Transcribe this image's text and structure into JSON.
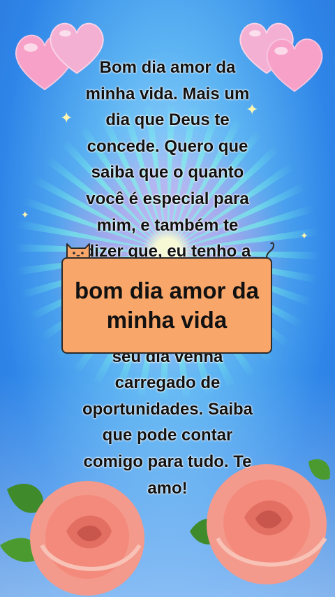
{
  "message": {
    "text": "Bom dia amor da\nminha vida. Mais um\ndia que Deus te\nconcede. Quero que\nsaiba que o quanto\nvocê é especial para\nmim, e também te\ndizer que, eu tenho a\n\n\namor e alegria. Que o\nseu dia venha\ncarregado de\noportunidades. Saiba\nque pode contar\ncomigo para tudo. Te\namo!"
  },
  "caption": {
    "text": "bom dia amor da\nminha vida"
  },
  "colors": {
    "caption_bg": "#f8a66a",
    "sky": "#2f86e8",
    "heart": "#f7a6cc",
    "rose": "#f2897d"
  },
  "icons": [
    "heart-icon",
    "rose-icon",
    "cat-icon",
    "sparkle-icon"
  ]
}
